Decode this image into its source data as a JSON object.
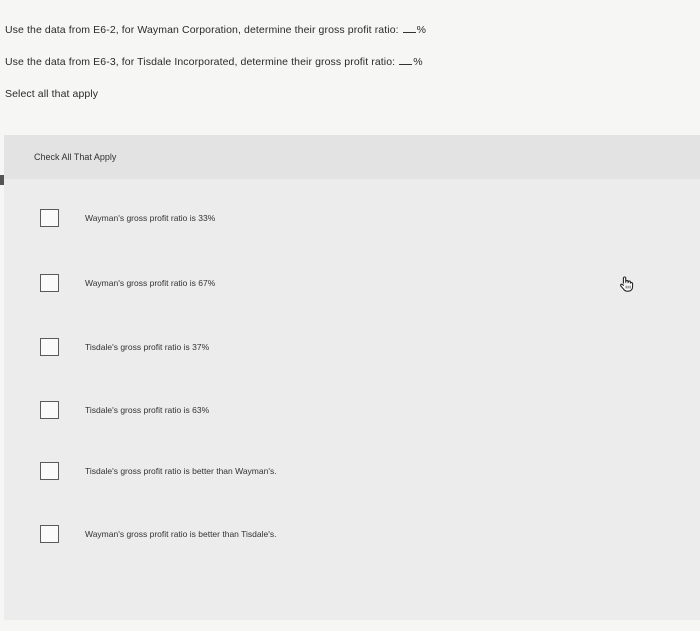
{
  "questions": {
    "q1_text": "Use the data from E6-2, for Wayman Corporation, determine their gross profit ratio:",
    "q1_suffix": "%",
    "q2_text": "Use the data from E6-3, for Tisdale Incorporated, determine their gross profit ratio:",
    "q2_suffix": "%",
    "instruction": "Select all that apply"
  },
  "panel": {
    "title": "Check All That Apply",
    "options": [
      {
        "label": "Wayman's gross profit ratio is 33%",
        "checked": false
      },
      {
        "label": "Wayman's gross profit ratio is 67%",
        "checked": false
      },
      {
        "label": "Tisdale's gross profit ratio is 37%",
        "checked": false
      },
      {
        "label": "Tisdale's gross profit ratio is 63%",
        "checked": false
      },
      {
        "label": "Tisdale's gross profit ratio is better than Wayman's.",
        "checked": false
      },
      {
        "label": "Wayman's gross profit ratio is better than Tisdale's.",
        "checked": false
      }
    ]
  },
  "icons": {
    "cursor": "hand-pointer-icon"
  }
}
